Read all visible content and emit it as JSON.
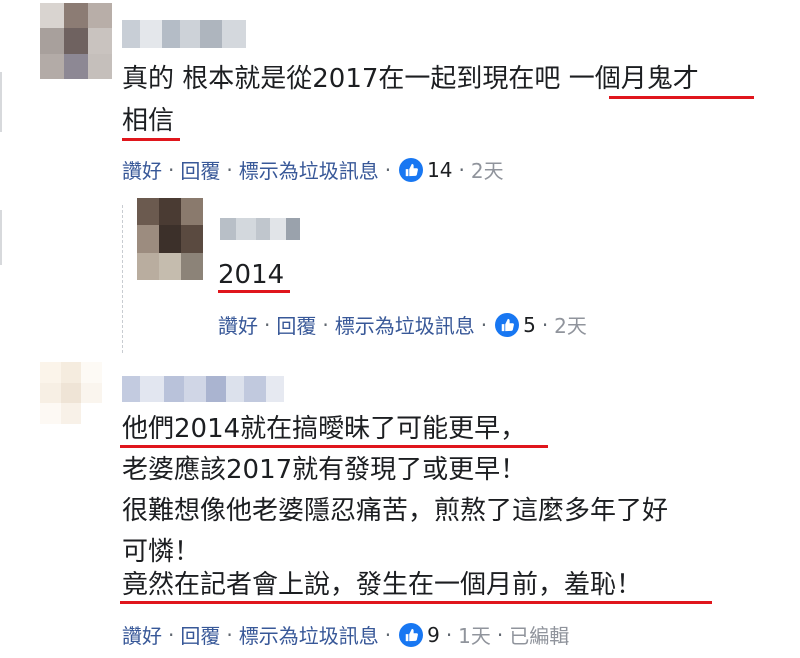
{
  "comments": [
    {
      "lines": [
        "真的 根本就是從2017在一起到現在吧 一個月鬼才",
        "相信"
      ],
      "actions": {
        "like": "讚好",
        "reply": "回覆",
        "spam": "標示為垃圾訊息",
        "likes": "14",
        "time": "2天"
      }
    },
    {
      "lines": [
        "2014"
      ],
      "actions": {
        "like": "讚好",
        "reply": "回覆",
        "spam": "標示為垃圾訊息",
        "likes": "5",
        "time": "2天"
      }
    },
    {
      "lines": [
        "他們2014就在搞曖昧了可能更早，",
        "老婆應該2017就有發現了或更早！",
        "很難想像他老婆隱忍痛苦，煎熬了這麼多年了好",
        "可憐！",
        "竟然在記者會上說，發生在一個月前，羞恥！"
      ],
      "actions": {
        "like": "讚好",
        "reply": "回覆",
        "spam": "標示為垃圾訊息",
        "likes": "9",
        "time": "1天",
        "edited": "已編輯"
      }
    }
  ],
  "dot": "·",
  "colors": {
    "link": "#385898",
    "underline": "#e0161c",
    "like_blue": "#1877f2",
    "text": "#1c1e21"
  },
  "icons": {
    "reaction": "thumbs-up-icon"
  }
}
